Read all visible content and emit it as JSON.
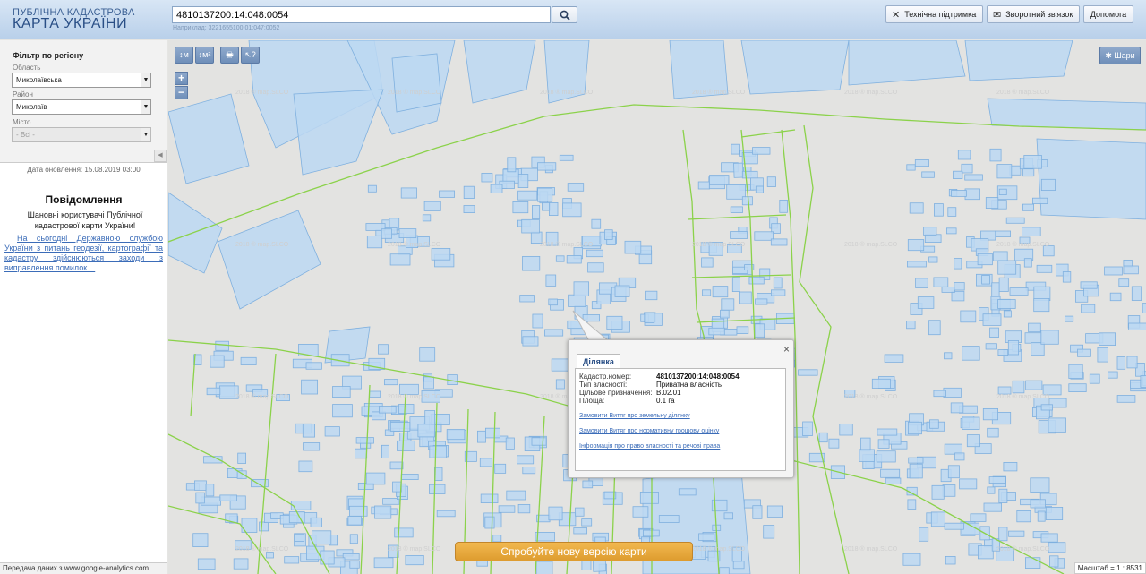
{
  "header": {
    "logo_line1": "ПУБЛІЧНА КАДАСТРОВА",
    "logo_line2": "КАРТА УКРАЇНИ",
    "search_value": "4810137200:14:048:0054",
    "search_example": "Наприклад: 3221655100:01:047:0052",
    "tech_support": "Технічна підтримка",
    "feedback": "Зворотний зв'язок",
    "help": "Допомога"
  },
  "filter": {
    "title": "Фільтр по регіону",
    "region_label": "Область",
    "region_value": "Миколаївська",
    "district_label": "Район",
    "district_value": "Миколаїв",
    "city_label": "Місто",
    "city_value": "- Всі -",
    "update_date": "Дата оновлення: 15.08.2019 03:00"
  },
  "notice": {
    "title": "Повідомлення",
    "body": "Шановні користувачі Публічної кадастрової карти України!",
    "link": "На сьогодні Державною службою України з питань геодезії, картографії та кадастру здійснюються заходи з виправлення помилок…"
  },
  "map": {
    "tools": [
      "↕м",
      "↕м²",
      "🖶",
      "↖?"
    ],
    "zoom_in": "+",
    "zoom_out": "−",
    "layers": "Шари",
    "try_new": "Спробуйте нову версію карти",
    "watermark": "2018 ® map.SLCO"
  },
  "popup": {
    "tab": "Ділянка",
    "close": "×",
    "fields": [
      {
        "label": "Кадастр.номер:",
        "value": "4810137200:14:048:0054"
      },
      {
        "label": "Тип власності:",
        "value": "Приватна власність"
      },
      {
        "label": "Цільове призначення:",
        "value": "В.02.01"
      },
      {
        "label": "Площа:",
        "value": "0.1 га"
      }
    ],
    "links": [
      "Замовити Витяг про земельну ділянку",
      "Замовити Витяг про нормативну грошову оцінку",
      "Інформація про право власності та речові права"
    ]
  },
  "status": {
    "transfer": "Передача даних з www.google-analytics.com…",
    "scale": "Масштаб = 1 : 8531"
  },
  "colors": {
    "parcel_fill": "#bcd8f2",
    "parcel_stroke": "#7fb0df",
    "boundary": "#8bd24a",
    "header_bg": "#c9dbef",
    "accent_orange": "#e6a83d"
  }
}
